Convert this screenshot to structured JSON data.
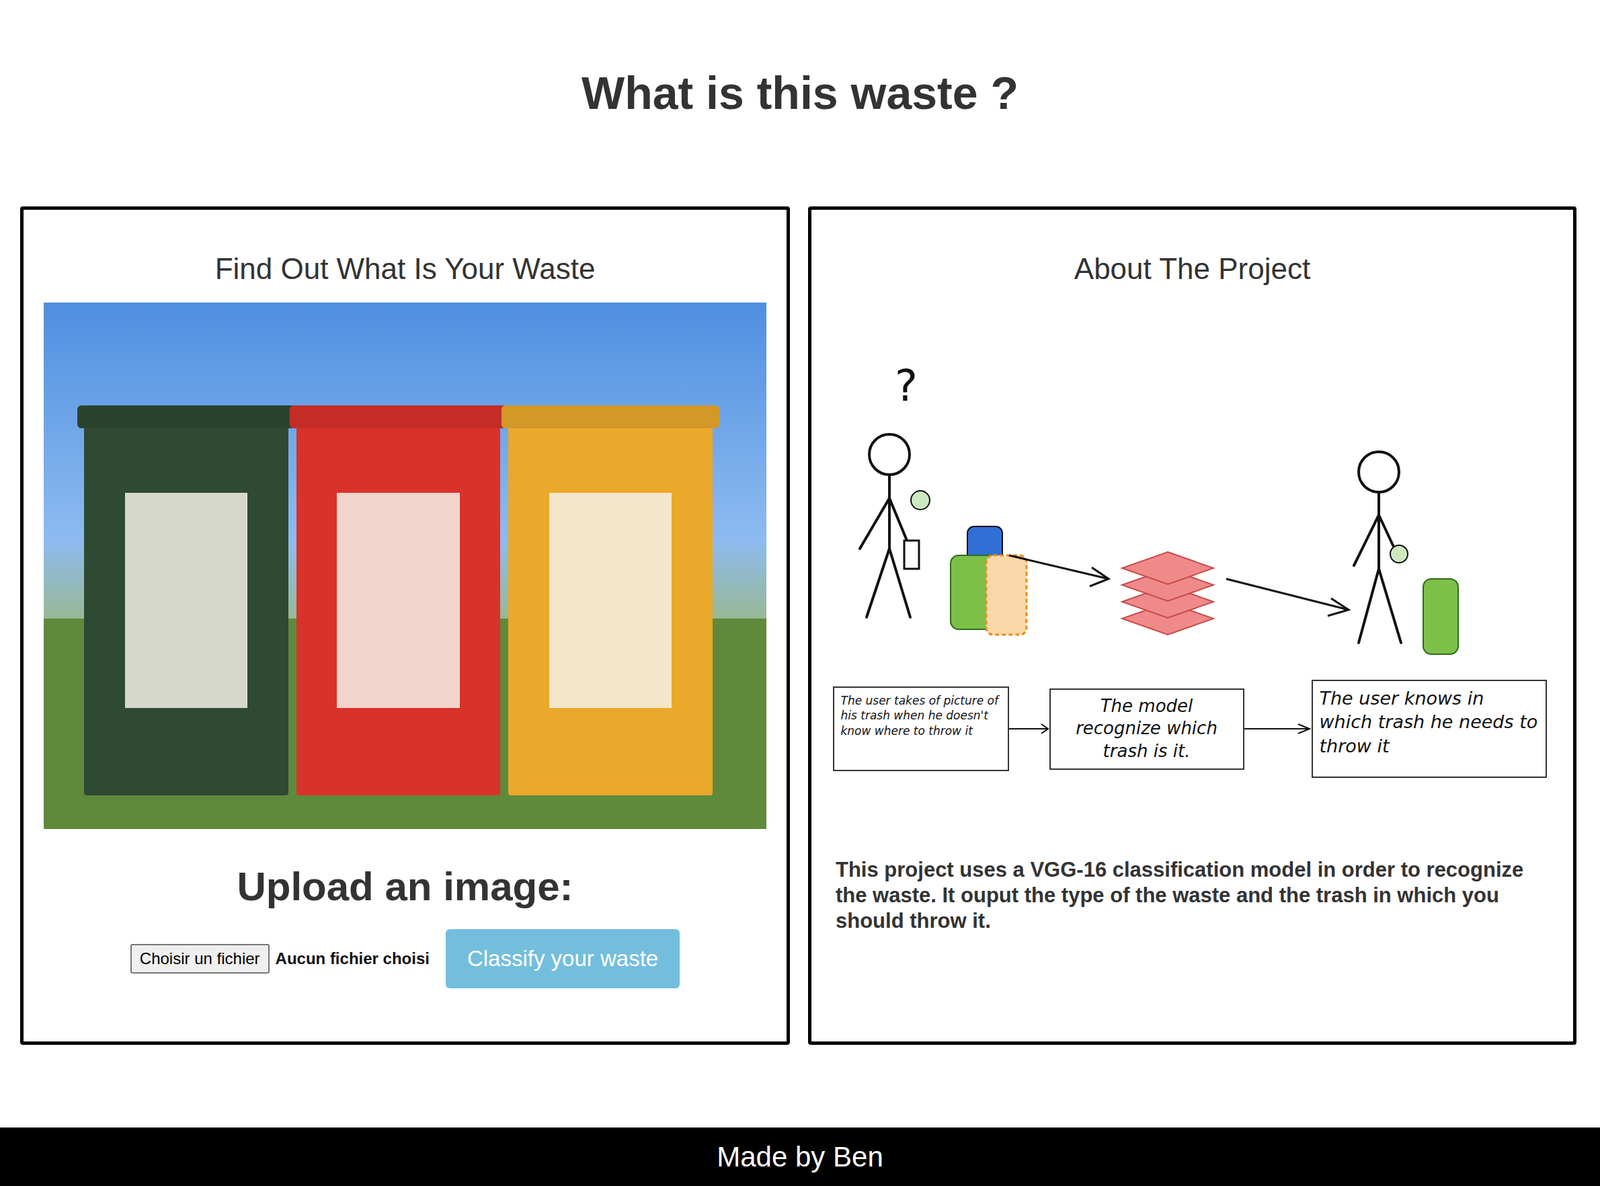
{
  "page": {
    "title": "What is this waste ?",
    "footer": "Made by Ben"
  },
  "upload_panel": {
    "heading": "Find Out What Is Your Waste",
    "upload_heading": "Upload an image:",
    "file_button": "Choisir un fichier",
    "file_status": "Aucun fichier choisi",
    "submit_button": "Classify your waste"
  },
  "about_panel": {
    "heading": "About The Project",
    "diagram": {
      "question_mark": "?",
      "steps": [
        {
          "text": "The user takes of picture of his trash when he doesn't know where to throw it"
        },
        {
          "text": "The model recognize which trash is it."
        },
        {
          "text": "The user knows in which trash he needs to throw it"
        }
      ]
    },
    "description": "This project uses a VGG-16 classification model in order to recognize the waste. It ouput the type of the waste and the trash in which you should throw it."
  }
}
